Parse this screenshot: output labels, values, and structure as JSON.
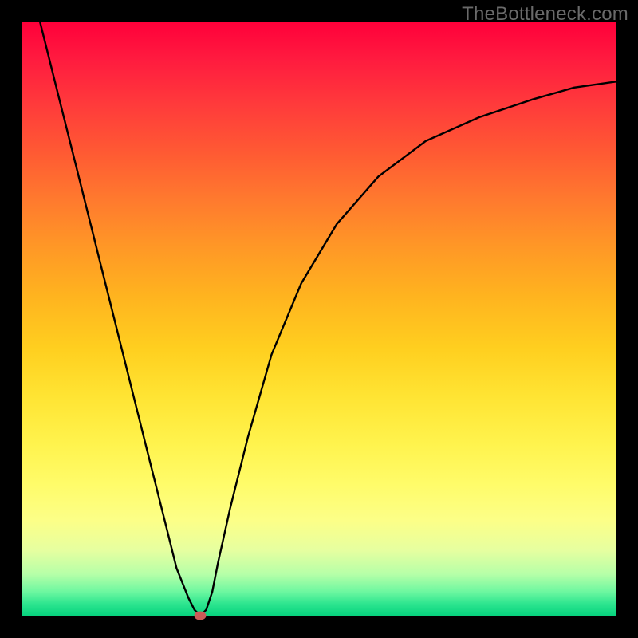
{
  "watermark": "TheBottleneck.com",
  "chart_data": {
    "type": "line",
    "title": "",
    "xlabel": "",
    "ylabel": "",
    "xlim": [
      0,
      100
    ],
    "ylim": [
      0,
      100
    ],
    "grid": false,
    "legend": false,
    "background": "rainbow-vertical-gradient",
    "series": [
      {
        "name": "bottleneck-curve",
        "x": [
          3,
          6,
          9,
          12,
          15,
          18,
          21,
          24,
          26,
          28,
          29,
          30,
          31,
          32,
          33,
          35,
          38,
          42,
          47,
          53,
          60,
          68,
          77,
          86,
          93,
          100
        ],
        "y": [
          100,
          88,
          76,
          64,
          52,
          40,
          28,
          16,
          8,
          3,
          1,
          0,
          1,
          4,
          9,
          18,
          30,
          44,
          56,
          66,
          74,
          80,
          84,
          87,
          89,
          90
        ]
      }
    ],
    "marker": {
      "x": 30,
      "y": 0,
      "color": "#cc5a57"
    },
    "colors": {
      "curve": "#000000",
      "frame": "#000000",
      "gradient_top": "#ff003a",
      "gradient_bottom": "#07d37e"
    }
  }
}
